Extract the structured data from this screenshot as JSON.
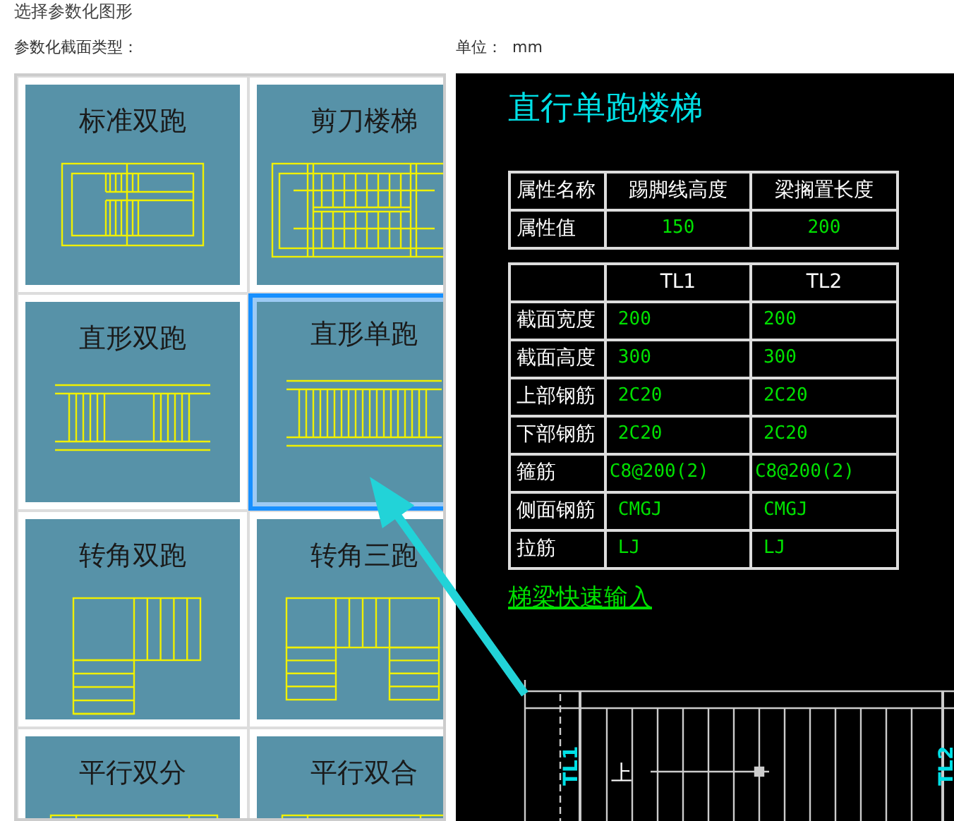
{
  "dialog": {
    "title": "选择参数化图形"
  },
  "section_label": "参数化截面类型：",
  "unit": {
    "label": "单位：",
    "value": "mm"
  },
  "thumbnails": [
    {
      "label": "标准双跑",
      "kind": "standard-double",
      "selected": false
    },
    {
      "label": "剪刀楼梯",
      "kind": "scissor",
      "selected": false
    },
    {
      "label": "直形双跑",
      "kind": "straight-double",
      "selected": false
    },
    {
      "label": "直形单跑",
      "kind": "straight-single",
      "selected": true
    },
    {
      "label": "转角双跑",
      "kind": "corner-double",
      "selected": false
    },
    {
      "label": "转角三跑",
      "kind": "corner-triple",
      "selected": false
    },
    {
      "label": "平行双分",
      "kind": "parallel-split",
      "selected": false
    },
    {
      "label": "平行双合",
      "kind": "parallel-merge",
      "selected": false
    }
  ],
  "preview": {
    "title": "直行单跑楼梯",
    "property_table": {
      "header": [
        "属性名称",
        "踢脚线高度",
        "梁搁置长度"
      ],
      "row": {
        "label": "属性值",
        "values": [
          "150",
          "200"
        ]
      }
    },
    "beam_table": {
      "columns": [
        "TL1",
        "TL2"
      ],
      "rows": [
        {
          "label": "截面宽度",
          "values": [
            "200",
            "200"
          ]
        },
        {
          "label": "截面高度",
          "values": [
            "300",
            "300"
          ]
        },
        {
          "label": "上部钢筋",
          "values": [
            "2C20",
            "2C20"
          ]
        },
        {
          "label": "下部钢筋",
          "values": [
            "2C20",
            "2C20"
          ]
        },
        {
          "label": "箍筋",
          "values": [
            "C8@200(2)",
            "C8@200(2)"
          ]
        },
        {
          "label": "侧面钢筋",
          "values": [
            "CMGJ",
            "CMGJ"
          ]
        },
        {
          "label": "拉筋",
          "values": [
            "LJ",
            "LJ"
          ]
        }
      ]
    },
    "link": "梯梁快速输入",
    "plan": {
      "left_beam": "TL1",
      "direction": "上",
      "right_beam": "TL2"
    }
  }
}
